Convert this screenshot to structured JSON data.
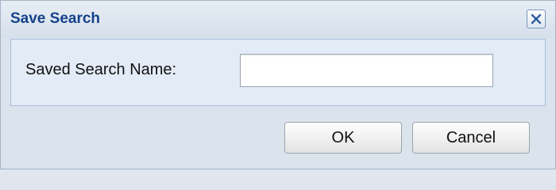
{
  "dialog": {
    "title": "Save Search",
    "close_icon": "close-icon"
  },
  "form": {
    "name_label": "Saved Search Name:",
    "name_value": "",
    "name_placeholder": ""
  },
  "buttons": {
    "ok_label": "OK",
    "cancel_label": "Cancel"
  },
  "colors": {
    "title_text": "#15428b",
    "dialog_background": "#dbe3ec",
    "panel_background": "#e3ebf6",
    "panel_border": "#a8bfdc"
  }
}
